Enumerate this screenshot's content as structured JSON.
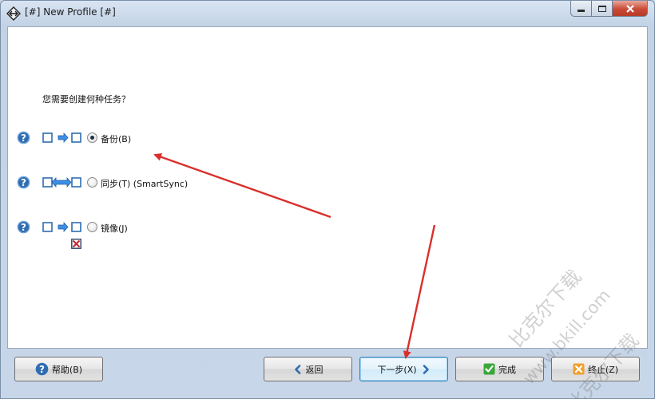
{
  "window": {
    "title": "[#] New Profile [#]"
  },
  "main": {
    "question": "您需要创建何种任务？",
    "options": [
      {
        "label": "备份(B)",
        "checked": true
      },
      {
        "label": "同步(T) (SmartSync)",
        "checked": false
      },
      {
        "label": "镜像(J)",
        "checked": false
      }
    ]
  },
  "buttons": {
    "help": "帮助(B)",
    "back": "返回",
    "next": "下一步(X)",
    "finish": "完成",
    "cancel": "终止(Z)"
  },
  "watermark": {
    "line1": "比克尔下载",
    "line2": "www.bkill.com",
    "line3": "比克尔下载"
  },
  "colors": {
    "accent": "#3c7fb1",
    "annotation_arrow": "#d9302b",
    "help_icon": "#2f6db0",
    "content_bg": "#ffffff"
  },
  "icons": {
    "app": "diamond-app-icon",
    "help": "question-circle-icon",
    "back": "chevron-left-icon",
    "next": "chevron-right-icon",
    "finish": "checkmark-icon",
    "cancel": "x-cancel-icon"
  }
}
